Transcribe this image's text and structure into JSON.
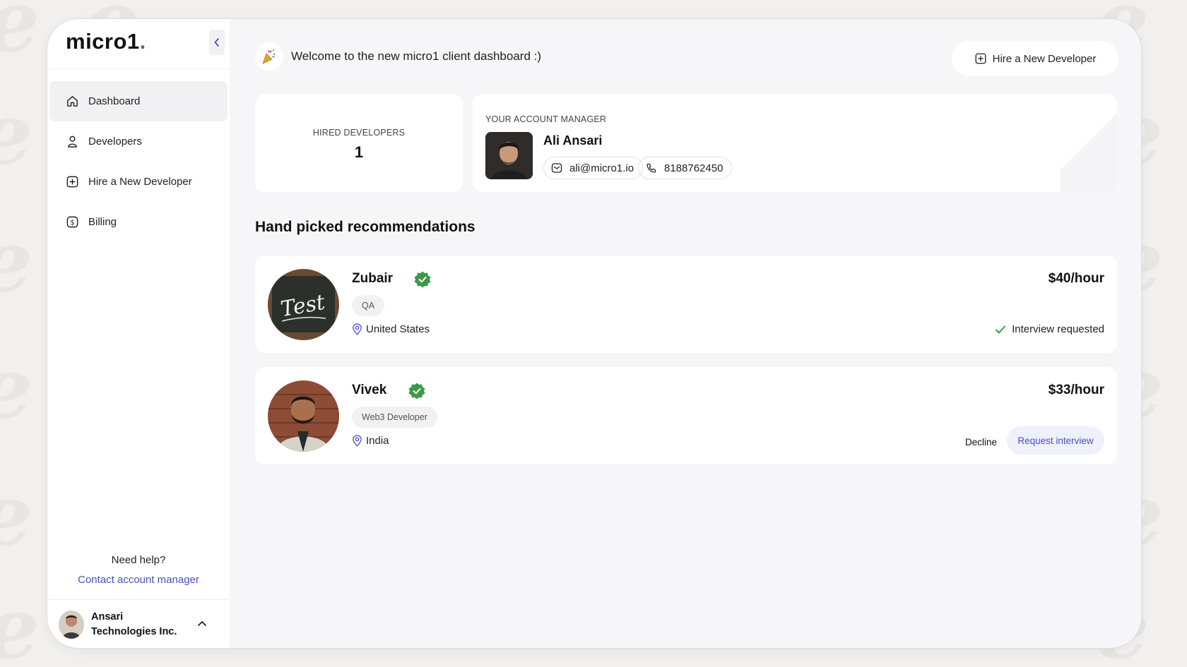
{
  "app": {
    "logo_text": "micro1",
    "logo_dot": ".",
    "brand_color": "#5b5fc7"
  },
  "sidebar": {
    "collapse_icon": "chevron-left-icon",
    "items": [
      {
        "label": "Dashboard",
        "icon": "home-icon",
        "active": true
      },
      {
        "label": "Developers",
        "icon": "user-icon",
        "active": false
      },
      {
        "label": "Hire a New Developer",
        "icon": "plus-square-icon",
        "active": false
      },
      {
        "label": "Billing",
        "icon": "dollar-icon",
        "active": false
      }
    ],
    "help": {
      "title": "Need help?",
      "link": "Contact account manager"
    },
    "account": {
      "name": "Ansari Technologies Inc.",
      "chevron_icon": "chevron-up-icon"
    }
  },
  "header": {
    "welcome_icon": "party-popper-icon",
    "welcome_text": "Welcome to the new micro1 client dashboard :)",
    "hire_button": "Hire a New Developer"
  },
  "stats": {
    "hired_label": "HIRED DEVELOPERS",
    "hired_value": "1"
  },
  "account_manager": {
    "label": "YOUR ACCOUNT MANAGER",
    "name": "Ali Ansari",
    "email": "ali@micro1.io",
    "phone": "8188762450"
  },
  "recommendations": {
    "title": "Hand picked recommendations",
    "items": [
      {
        "name": "Zubair",
        "role": "QA",
        "location": "United States",
        "rate": "$40/hour",
        "status": "Interview requested",
        "photo_text": "Test"
      },
      {
        "name": "Vivek",
        "role": "Web3 Developer",
        "location": "India",
        "rate": "$33/hour",
        "decline": "Decline",
        "request": "Request interview"
      }
    ]
  },
  "colors": {
    "verified_badge": "#3c9a49",
    "link": "#4a4fc2",
    "background": "#f6f6f8"
  }
}
